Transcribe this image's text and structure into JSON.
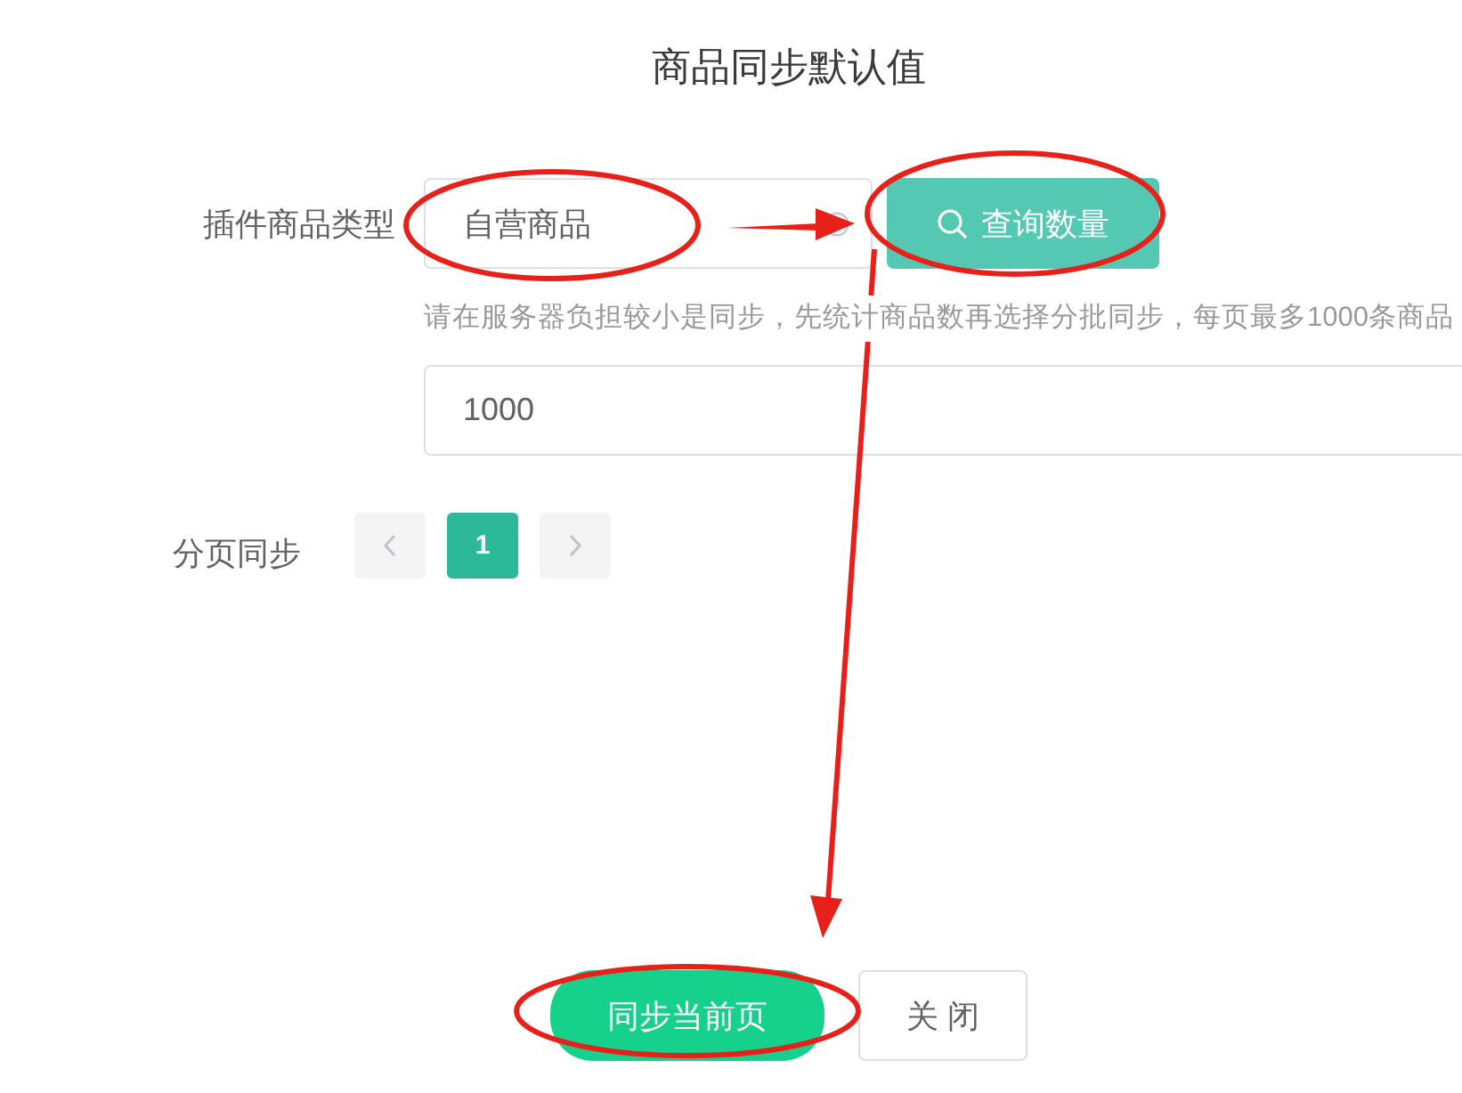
{
  "title": "商品同步默认值",
  "product_type": {
    "label": "插件商品类型",
    "value": "自营商品"
  },
  "query_button": {
    "label": "查询数量"
  },
  "hint": "请在服务器负担较小是同步，先统计商品数再选择分批同步，每页最多1000条商品",
  "page_size": {
    "value": "1000"
  },
  "pagination": {
    "label": "分页同步",
    "prev": {
      "disabled": true
    },
    "pages": [
      {
        "label": "1",
        "selected": true
      }
    ],
    "next": {
      "disabled": true
    }
  },
  "buttons": [
    {
      "label": "同步当前页",
      "kind": "primary"
    },
    {
      "label": "关 闭",
      "kind": "default"
    }
  ]
}
